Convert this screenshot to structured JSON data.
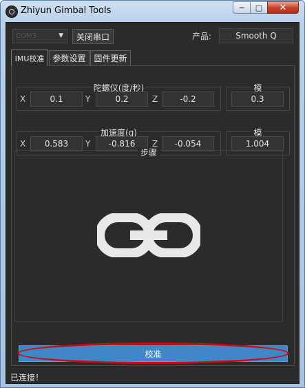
{
  "window": {
    "title": "Zhiyun Gimbal Tools",
    "controls": {
      "minimize": "─",
      "maximize": "□",
      "close": "✕"
    }
  },
  "toolbar": {
    "port_value": "COM3",
    "close_port_label": "关闭串口",
    "product_label": "产品:",
    "product_value": "Smooth Q"
  },
  "tabs": [
    {
      "label": "IMU校准",
      "active": true
    },
    {
      "label": "参数设置",
      "active": false
    },
    {
      "label": "固件更新",
      "active": false
    }
  ],
  "gyro": {
    "title": "陀螺仪(度/秒)",
    "x_label": "X",
    "x": "0.1",
    "y_label": "Y",
    "y": "0.2",
    "z_label": "Z",
    "z": "-0.2",
    "mod_title": "模",
    "mod": "0.3"
  },
  "accel": {
    "title": "加速度(g)",
    "x_label": "X",
    "x": "0.583",
    "y_label": "Y",
    "y": "-0.816",
    "z_label": "Z",
    "z": "-0.054",
    "mod_title": "模",
    "mod": "1.004"
  },
  "steps": {
    "title": "步骤",
    "icon": "link-icon"
  },
  "calibrate_label": "校准",
  "status_text": "已连接！",
  "colors": {
    "background": "#2b2b2b",
    "accent": "#3f87c7",
    "highlight": "#d40a0a"
  }
}
